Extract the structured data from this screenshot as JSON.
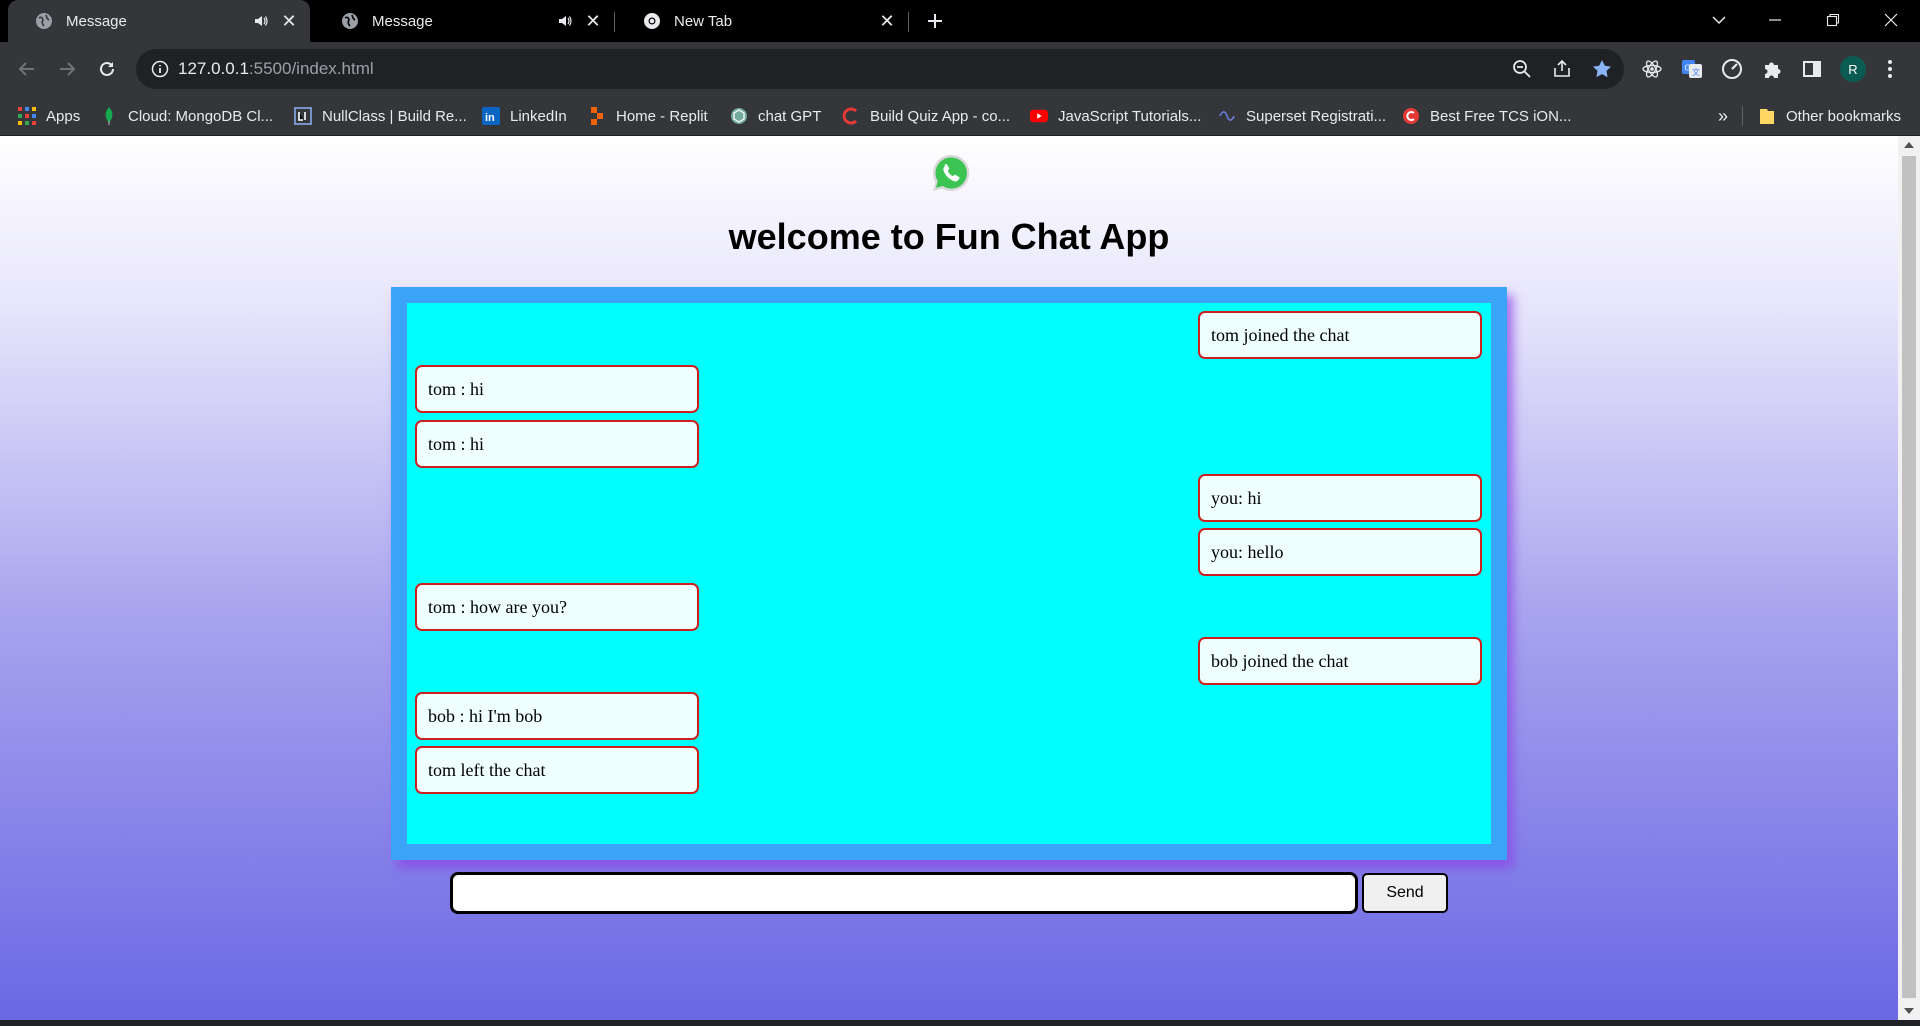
{
  "browser": {
    "tabs": [
      {
        "title": "Message",
        "icon": "globe-icon",
        "muted_icon": "speaker-icon",
        "active": true
      },
      {
        "title": "Message",
        "icon": "globe-icon",
        "muted_icon": "speaker-icon",
        "active": false
      },
      {
        "title": "New Tab",
        "icon": "chrome-icon",
        "active": false
      }
    ],
    "url_host": "127.0.0.1",
    "url_rest": ":5500/index.html",
    "profile_initial": "R",
    "bookmarks": [
      {
        "label": "Apps",
        "icon": "apps-grid-icon"
      },
      {
        "label": "Cloud: MongoDB Cl...",
        "icon": "mongodb-leaf-icon"
      },
      {
        "label": "NullClass | Build Re...",
        "icon": "nullclass-icon"
      },
      {
        "label": "LinkedIn",
        "icon": "linkedin-icon"
      },
      {
        "label": "Home - Replit",
        "icon": "replit-icon"
      },
      {
        "label": "chat GPT",
        "icon": "openai-icon"
      },
      {
        "label": "Build Quiz App - co...",
        "icon": "codehelp-icon"
      },
      {
        "label": "JavaScript Tutorials...",
        "icon": "youtube-icon"
      },
      {
        "label": "Superset Registrati...",
        "icon": "superset-icon"
      },
      {
        "label": "Best Free TCS iON...",
        "icon": "tcs-icon"
      }
    ],
    "bookmarks_overflow": "»",
    "other_bookmarks": "Other bookmarks",
    "colors": {
      "tabstrip": "#000000",
      "toolbar": "#35363a",
      "star": "#8ab4f8"
    }
  },
  "app": {
    "title": "welcome to Fun Chat App",
    "logo_icon": "whatsapp-icon",
    "messages": [
      {
        "text": "tom joined the chat",
        "side": "right"
      },
      {
        "text": "tom : hi",
        "side": "left"
      },
      {
        "text": "tom : hi",
        "side": "left"
      },
      {
        "text": "you: hi",
        "side": "right"
      },
      {
        "text": "you: hello",
        "side": "right"
      },
      {
        "text": "tom : how are you?",
        "side": "left"
      },
      {
        "text": "bob joined the chat",
        "side": "right"
      },
      {
        "text": "bob : hi I'm bob",
        "side": "left"
      },
      {
        "text": "tom left the chat",
        "side": "left"
      }
    ],
    "input_value": "",
    "send_label": "Send",
    "colors": {
      "chat_frame": "#3ba4f7",
      "chat_bg": "#00ffff",
      "message_bg": "#effffe",
      "message_border": "#cc2020"
    }
  }
}
